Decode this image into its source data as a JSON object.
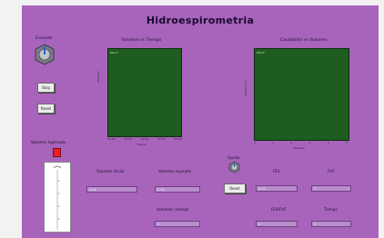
{
  "app_title": "Hidroespirometria",
  "controls": {
    "knob_label": "Encender",
    "stop_label": "Stop",
    "reset_label": "Reset",
    "volume_label": "Volumen ingresado"
  },
  "plots": [
    {
      "title": "Volumen vs Tiempo",
      "legend": "Plot 0",
      "ylabel": "Volumen",
      "xlabel": "Tiempo",
      "xticks": [
        "00:00",
        "00:05",
        "00:10",
        "00:15",
        "00:20"
      ]
    },
    {
      "title": "Caudal(l/s) vs Volumen",
      "legend": "Plot 0",
      "ylabel": "Caudal (l/s)",
      "xlabel": "Volumen",
      "xticks": [
        "0",
        "1",
        "2",
        "3",
        "4",
        "5"
      ]
    }
  ],
  "readouts": {
    "volumen_inicial_label": "Volumen inicial",
    "volumen_inicial_value": "0.00",
    "volumen_espirado_label": "Volumen espirado",
    "volumen_espirado_value": "0.00",
    "volumen_tiempo_label": "Volumen / tiempo",
    "volumen_tiempo_value": "0",
    "zero_knob_label": "Ajustar",
    "zero_button_label": "Reset",
    "fev_label": "FEV",
    "fev_value": "0.00",
    "fvc_label": "FVC",
    "fvc_value": "0",
    "fev_fvc_label": "FEV/FVC",
    "fev_fvc_value": "0",
    "tiempo_label": "Tiempo",
    "tiempo_value": "0"
  },
  "colors": {
    "panel": "#a864bb",
    "plot_bg": "#1f5c1f",
    "led": "#e8202a"
  }
}
